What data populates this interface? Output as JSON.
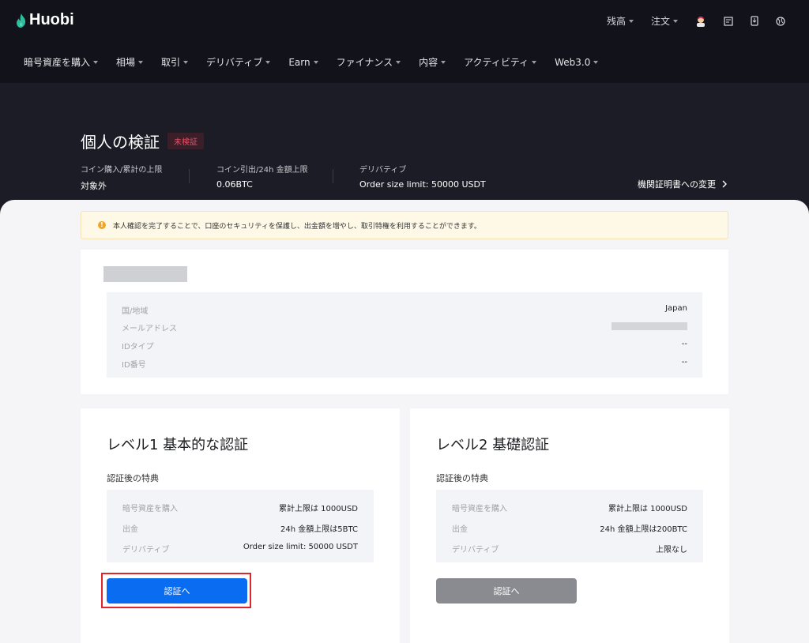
{
  "brand": {
    "name": "Huobi"
  },
  "header": {
    "right": {
      "balance": "残高",
      "orders": "注文"
    },
    "nav": [
      "暗号資産を購入",
      "相場",
      "取引",
      "デリバティブ",
      "Earn",
      "ファイナンス",
      "内容",
      "アクティビティ",
      "Web3.0"
    ]
  },
  "hero": {
    "title": "個人の検証",
    "badge": "未検証",
    "stats": [
      {
        "label": "コイン購入/累計の上限",
        "value": "対象外"
      },
      {
        "label": "コイン引出/24h 金額上限",
        "value": "0.06BTC"
      },
      {
        "label": "デリバティブ",
        "value": "Order size limit: 50000 USDT"
      }
    ],
    "change_link": "機関証明書への変更"
  },
  "notice": "本人確認を完了することで、口座のセキュリティを保護し、出金額を増やし、取引特権を利用することができます。",
  "info": {
    "rows": [
      {
        "label": "国/地域",
        "value": "Japan"
      },
      {
        "label": "メールアドレス",
        "value": ""
      },
      {
        "label": "IDタイプ",
        "value": "--"
      },
      {
        "label": "ID番号",
        "value": "--"
      }
    ]
  },
  "levels": [
    {
      "title": "レベル1 基本的な認証",
      "subtitle": "認証後の特典",
      "rows": [
        {
          "label": "暗号資産を購入",
          "value": "累計上限は 1000USD"
        },
        {
          "label": "出金",
          "value": "24h 金額上限は5BTC"
        },
        {
          "label": "デリバティブ",
          "value": "Order size limit: 50000 USDT"
        }
      ],
      "button": "認証へ"
    },
    {
      "title": "レベル2 基礎認証",
      "subtitle": "認証後の特典",
      "rows": [
        {
          "label": "暗号資産を購入",
          "value": "累計上限は 1000USD"
        },
        {
          "label": "出金",
          "value": "24h 金額上限は200BTC"
        },
        {
          "label": "デリバティブ",
          "value": "上限なし"
        }
      ],
      "button": "認証へ"
    }
  ],
  "colors": {
    "accent": "#0a6cf0",
    "highlight": "#e0252c",
    "brand_green": "#2bbf9d"
  }
}
